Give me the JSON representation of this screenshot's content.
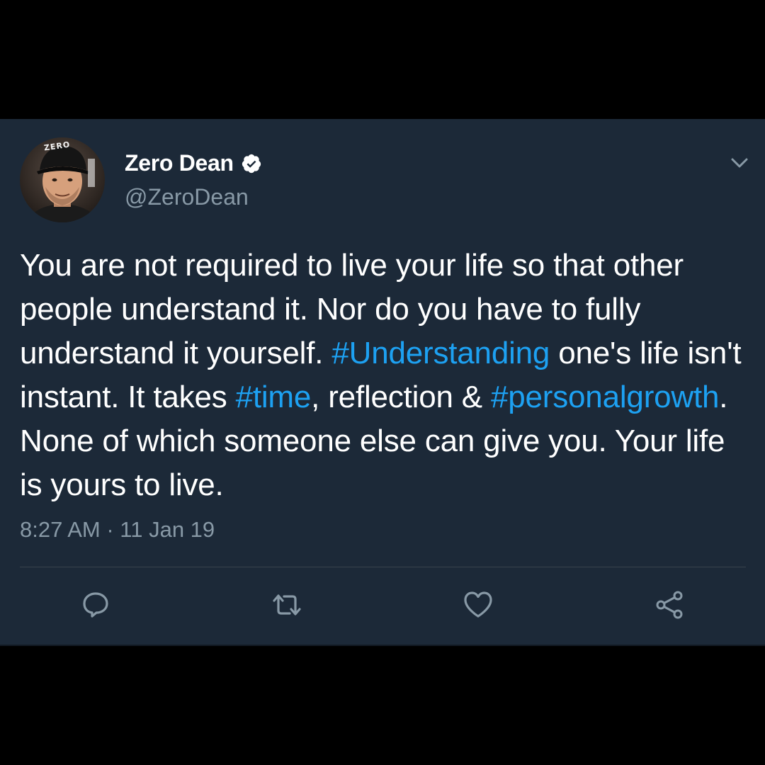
{
  "tweet": {
    "display_name": "Zero Dean",
    "handle": "@ZeroDean",
    "verified": true,
    "avatar_cap_text": "ZERO",
    "text_segments": [
      {
        "type": "text",
        "value": "You are not required to live your life so that other people understand it. Nor do you have to fully understand it yourself. "
      },
      {
        "type": "hashtag",
        "value": "#Understanding"
      },
      {
        "type": "text",
        "value": " one's life isn't instant. It takes "
      },
      {
        "type": "hashtag",
        "value": "#time"
      },
      {
        "type": "text",
        "value": ", reflection & "
      },
      {
        "type": "hashtag",
        "value": "#personalgrowth"
      },
      {
        "type": "text",
        "value": ". None of which someone else can give you. Your life is yours to live."
      }
    ],
    "timestamp": "8:27 AM · 11 Jan 19"
  },
  "actions": [
    {
      "name": "reply",
      "icon": "reply-icon"
    },
    {
      "name": "retweet",
      "icon": "retweet-icon"
    },
    {
      "name": "like",
      "icon": "heart-icon"
    },
    {
      "name": "share",
      "icon": "share-icon"
    }
  ],
  "colors": {
    "background": "#000000",
    "card": "#1c2938",
    "text": "#ffffff",
    "muted": "#8899a6",
    "hashtag": "#1da1f2",
    "divider": "#38444d"
  }
}
